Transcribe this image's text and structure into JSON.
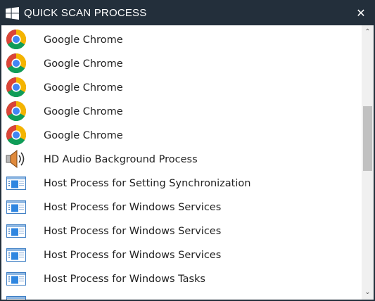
{
  "window": {
    "title": "QUICK SCAN PROCESS",
    "close_glyph": "✕"
  },
  "scrollbar": {
    "up_glyph": "⌃",
    "down_glyph": "⌄"
  },
  "processes": [
    {
      "name": "Google Chrome",
      "icon": "chrome-icon"
    },
    {
      "name": "Google Chrome",
      "icon": "chrome-icon"
    },
    {
      "name": "Google Chrome",
      "icon": "chrome-icon"
    },
    {
      "name": "Google Chrome",
      "icon": "chrome-icon"
    },
    {
      "name": "Google Chrome",
      "icon": "chrome-icon"
    },
    {
      "name": "HD Audio Background Process",
      "icon": "speaker-icon"
    },
    {
      "name": "Host Process for Setting Synchronization",
      "icon": "app-window-icon"
    },
    {
      "name": "Host Process for Windows Services",
      "icon": "app-window-icon"
    },
    {
      "name": "Host Process for Windows Services",
      "icon": "app-window-icon"
    },
    {
      "name": "Host Process for Windows Services",
      "icon": "app-window-icon"
    },
    {
      "name": "Host Process for Windows Tasks",
      "icon": "app-window-icon"
    },
    {
      "name": "",
      "icon": "app-window-icon"
    }
  ],
  "colors": {
    "titlebar": "#232f3b",
    "title_text": "#ffffff"
  }
}
